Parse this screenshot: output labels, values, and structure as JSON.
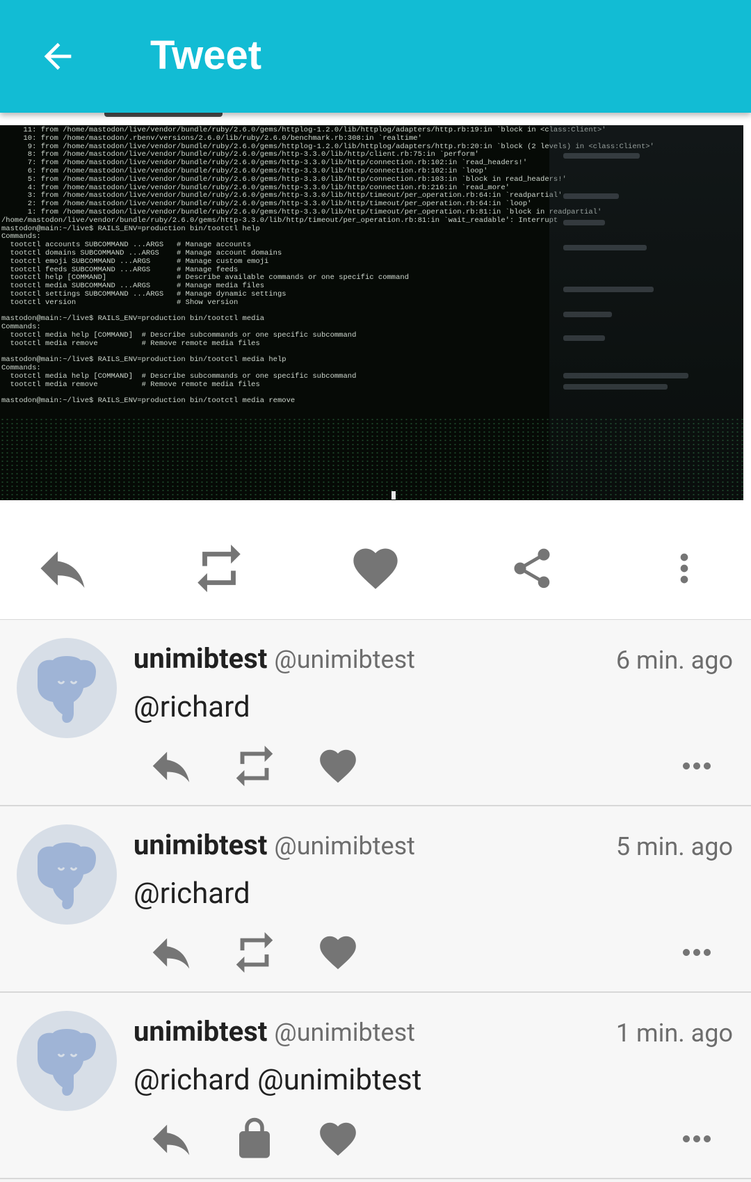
{
  "appbar": {
    "title": "Tweet",
    "back_icon": "arrow-back-icon",
    "color": "#12bcd4"
  },
  "status": {
    "media": {
      "description": "Terminal screenshot",
      "terminal_lines": [
        "     11: from /home/mastodon/live/vendor/bundle/ruby/2.6.0/gems/httplog-1.2.0/lib/httplog/adapters/http.rb:19:in `block in <class:Client>'",
        "     10: from /home/mastodon/.rbenv/versions/2.6.0/lib/ruby/2.6.0/benchmark.rb:308:in `realtime'",
        "      9: from /home/mastodon/live/vendor/bundle/ruby/2.6.0/gems/httplog-1.2.0/lib/httplog/adapters/http.rb:20:in `block (2 levels) in <class:Client>'",
        "      8: from /home/mastodon/live/vendor/bundle/ruby/2.6.0/gems/http-3.3.0/lib/http/client.rb:75:in `perform'",
        "      7: from /home/mastodon/live/vendor/bundle/ruby/2.6.0/gems/http-3.3.0/lib/http/connection.rb:102:in `read_headers!'",
        "      6: from /home/mastodon/live/vendor/bundle/ruby/2.6.0/gems/http-3.3.0/lib/http/connection.rb:102:in `loop'",
        "      5: from /home/mastodon/live/vendor/bundle/ruby/2.6.0/gems/http-3.3.0/lib/http/connection.rb:103:in `block in read_headers!'",
        "      4: from /home/mastodon/live/vendor/bundle/ruby/2.6.0/gems/http-3.3.0/lib/http/connection.rb:216:in `read_more'",
        "      3: from /home/mastodon/live/vendor/bundle/ruby/2.6.0/gems/http-3.3.0/lib/http/timeout/per_operation.rb:64:in `readpartial'",
        "      2: from /home/mastodon/live/vendor/bundle/ruby/2.6.0/gems/http-3.3.0/lib/http/timeout/per_operation.rb:64:in `loop'",
        "      1: from /home/mastodon/live/vendor/bundle/ruby/2.6.0/gems/http-3.3.0/lib/http/timeout/per_operation.rb:81:in `block in readpartial'",
        "/home/mastodon/live/vendor/bundle/ruby/2.6.0/gems/http-3.3.0/lib/http/timeout/per_operation.rb:81:in `wait_readable': Interrupt",
        "mastodon@main:~/live$ RAILS_ENV=production bin/tootctl help",
        "Commands:",
        "  tootctl accounts SUBCOMMAND ...ARGS   # Manage accounts",
        "  tootctl domains SUBCOMMAND ...ARGS    # Manage account domains",
        "  tootctl emoji SUBCOMMAND ...ARGS      # Manage custom emoji",
        "  tootctl feeds SUBCOMMAND ...ARGS      # Manage feeds",
        "  tootctl help [COMMAND]                # Describe available commands or one specific command",
        "  tootctl media SUBCOMMAND ...ARGS      # Manage media files",
        "  tootctl settings SUBCOMMAND ...ARGS   # Manage dynamic settings",
        "  tootctl version                       # Show version",
        "",
        "mastodon@main:~/live$ RAILS_ENV=production bin/tootctl media",
        "Commands:",
        "  tootctl media help [COMMAND]  # Describe subcommands or one specific subcommand",
        "  tootctl media remove          # Remove remote media files",
        "",
        "mastodon@main:~/live$ RAILS_ENV=production bin/tootctl media help",
        "Commands:",
        "  tootctl media help [COMMAND]  # Describe subcommands or one specific subcommand",
        "  tootctl media remove          # Remove remote media files",
        "",
        "mastodon@main:~/live$ RAILS_ENV=production bin/tootctl media remove"
      ]
    },
    "actions": [
      "reply-icon",
      "boost-icon",
      "favourite-icon",
      "share-icon",
      "more-vert-icon"
    ]
  },
  "replies": [
    {
      "display_name": "unimibtest",
      "handle": "@unimibtest",
      "time": "6 min. ago",
      "content": "@richard",
      "boost_icon": "boost-icon"
    },
    {
      "display_name": "unimibtest",
      "handle": "@unimibtest",
      "time": "5 min. ago",
      "content": "@richard",
      "boost_icon": "boost-icon"
    },
    {
      "display_name": "unimibtest",
      "handle": "@unimibtest",
      "time": "1 min. ago",
      "content": "@richard @unimibtest",
      "boost_icon": "lock-icon"
    }
  ],
  "colors": {
    "icon": "#757575",
    "avatar_bg": "#d7dee7",
    "elephant": "#9fb4d6"
  }
}
